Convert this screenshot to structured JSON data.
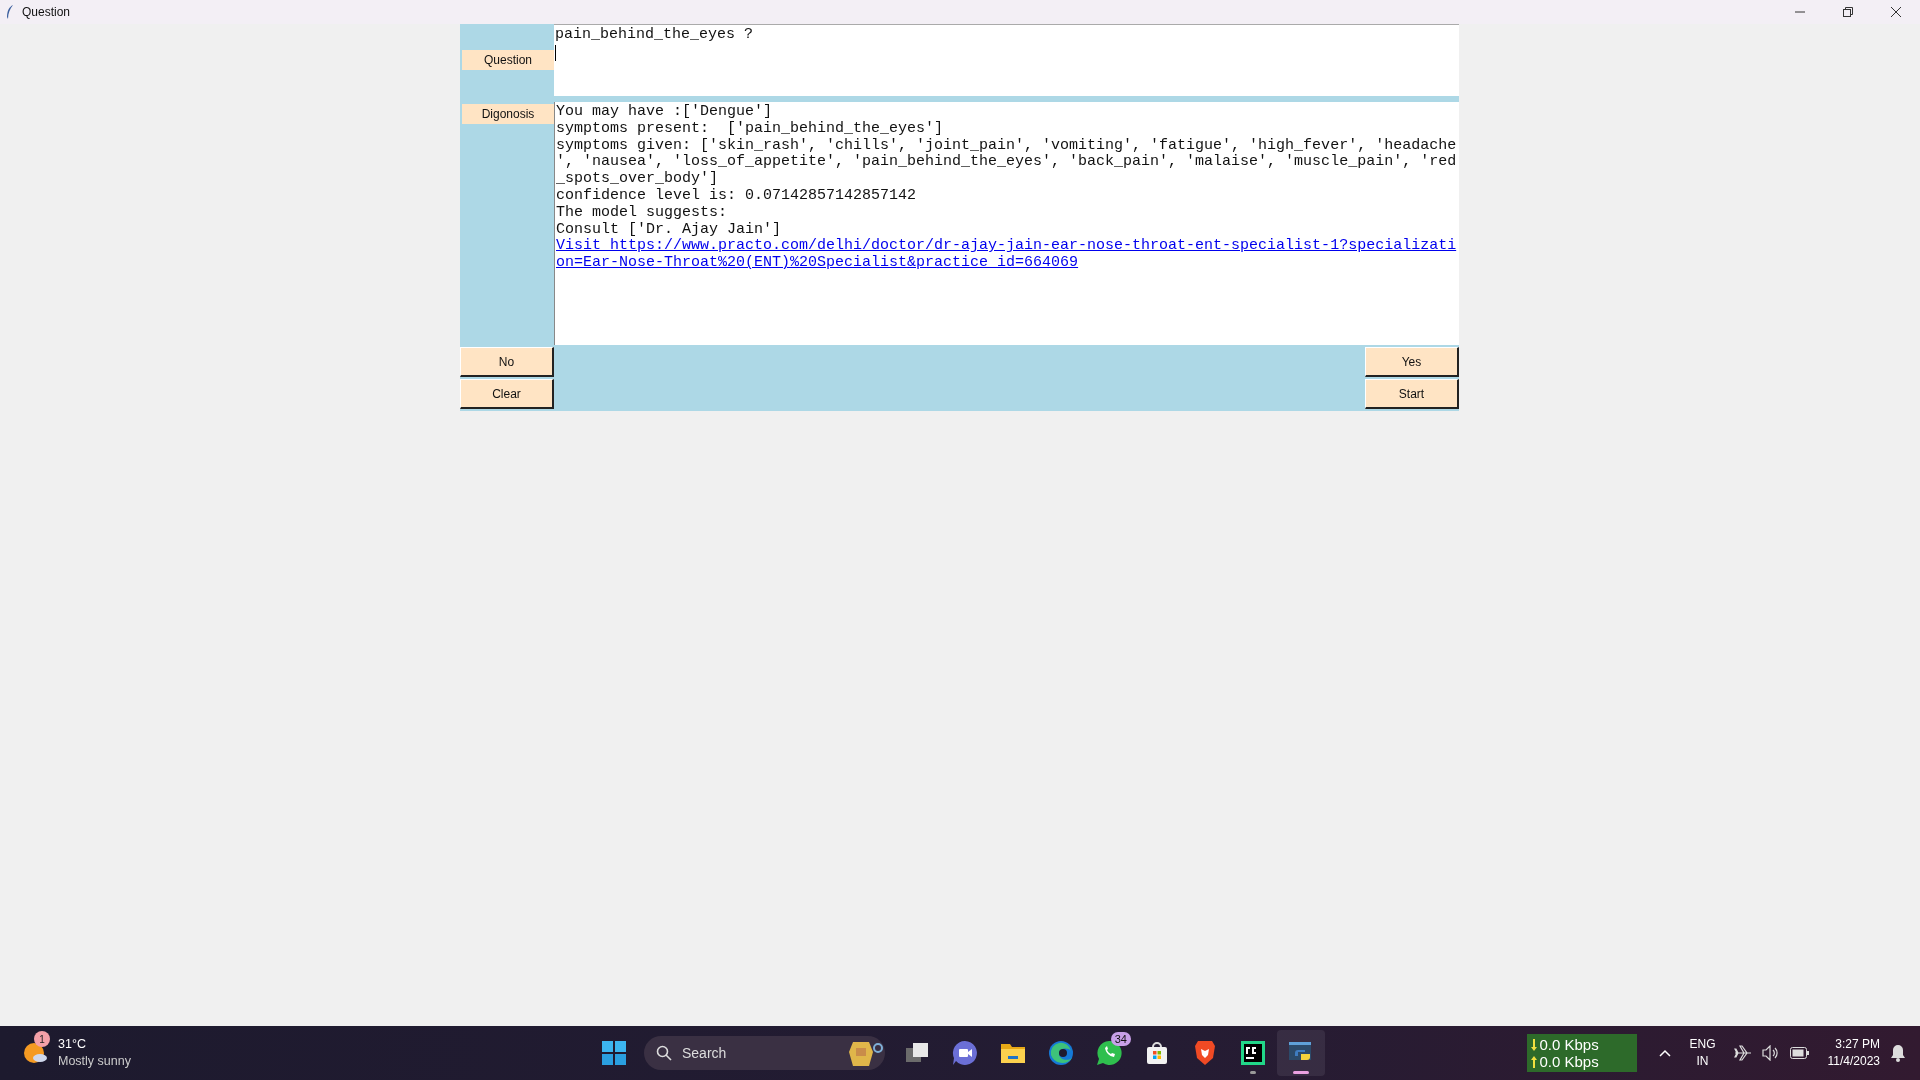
{
  "window": {
    "title": "Question"
  },
  "question": {
    "label": "Question",
    "lines": [
      "pain_behind_the_eyes ?"
    ]
  },
  "diagnosis": {
    "label": "Digonosis",
    "lines": [
      {
        "kind": "text",
        "text": "You may have :['Dengue']"
      },
      {
        "kind": "text",
        "text": "symptoms present:  ['pain_behind_the_eyes']"
      },
      {
        "kind": "text",
        "text": "symptoms given: ['skin_rash', 'chills', 'joint_pain', 'vomiting', 'fatigue', 'high_fever', 'headache"
      },
      {
        "kind": "text",
        "text": "', 'nausea', 'loss_of_appetite', 'pain_behind_the_eyes', 'back_pain', 'malaise', 'muscle_pain', 'red"
      },
      {
        "kind": "text",
        "text": "_spots_over_body']"
      },
      {
        "kind": "text",
        "text": "confidence level is: 0.07142857142857142"
      },
      {
        "kind": "text",
        "text": "The model suggests:"
      },
      {
        "kind": "text",
        "text": "Consult ['Dr. Ajay Jain']"
      },
      {
        "kind": "link",
        "text": "Visit https://www.practo.com/delhi/doctor/dr-ajay-jain-ear-nose-throat-ent-specialist-1?specializati"
      },
      {
        "kind": "link",
        "text": "on=Ear-Nose-Throat%20(ENT)%20Specialist&practice_id=664069"
      }
    ]
  },
  "buttons_left": [
    "No",
    "Clear"
  ],
  "buttons_right": [
    "Yes",
    "Start"
  ],
  "taskbar": {
    "weather": {
      "temperature": "31°C",
      "condition": "Mostly sunny",
      "badge": "1"
    },
    "search": {
      "placeholder": "Search"
    },
    "apps": [
      {
        "kind": "task-view",
        "open": false,
        "selected": false
      },
      {
        "kind": "meet",
        "open": false,
        "selected": false
      },
      {
        "kind": "folder",
        "open": false,
        "selected": false
      },
      {
        "kind": "edge",
        "open": false,
        "selected": false
      },
      {
        "kind": "whatsapp",
        "badge": "34",
        "open": false,
        "selected": false
      },
      {
        "kind": "store",
        "open": false,
        "selected": false
      },
      {
        "kind": "brave",
        "open": false,
        "selected": false
      },
      {
        "kind": "pycharm",
        "open": true,
        "selected": false
      },
      {
        "kind": "python",
        "open": true,
        "selected": true
      }
    ],
    "network": [
      {
        "kind": "down",
        "text": "0.0 Kbps"
      },
      {
        "kind": "up",
        "text": "0.0 Kbps"
      }
    ],
    "language": [
      "ENG",
      "IN"
    ],
    "time": "3:27 PM",
    "date": "11/4/2023"
  }
}
